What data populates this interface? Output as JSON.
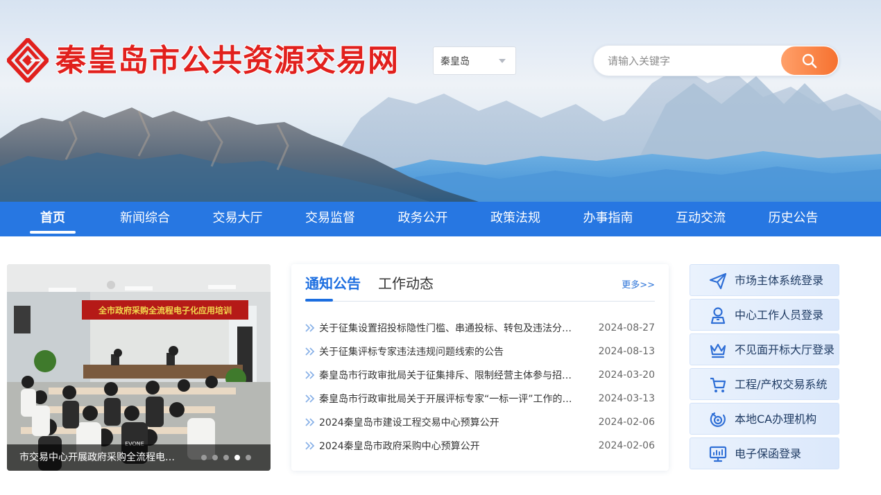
{
  "header": {
    "site_title": "秦皇岛市公共资源交易网",
    "region_select": {
      "value": "秦皇岛"
    },
    "search": {
      "placeholder": "请输入关键字"
    }
  },
  "nav": {
    "items": [
      {
        "label": "首页",
        "active": true
      },
      {
        "label": "新闻综合"
      },
      {
        "label": "交易大厅"
      },
      {
        "label": "交易监督"
      },
      {
        "label": "政务公开"
      },
      {
        "label": "政策法规"
      },
      {
        "label": "办事指南"
      },
      {
        "label": "互动交流"
      },
      {
        "label": "历史公告"
      }
    ]
  },
  "carousel": {
    "photo_banner_text": "全市政府采购全流程电子化应用培训",
    "shirt_text": "EVONE",
    "caption": "市交易中心开展政府采购全流程电子化应用培训",
    "slide_count": 5,
    "active_slide": 4
  },
  "notices": {
    "tabs": [
      "通知公告",
      "工作动态"
    ],
    "active_tab": 0,
    "more": "更多>>",
    "items": [
      {
        "title": "关于征集设置招投标隐性门槛、串通投标、转包及违法分包等违法违规问题线索的公告",
        "date": "2024-08-27"
      },
      {
        "title": "关于征集评标专家违法违规问题线索的公告",
        "date": "2024-08-13"
      },
      {
        "title": "秦皇岛市行政审批局关于征集排斥、限制经营主体参与招投标问题线索的公告",
        "date": "2024-03-20"
      },
      {
        "title": "秦皇岛市行政审批局关于开展评标专家“一标一评”工作的通知",
        "date": "2024-03-13"
      },
      {
        "title": "2024秦皇岛市建设工程交易中心预算公开",
        "date": "2024-02-06"
      },
      {
        "title": "2024秦皇岛市政府采购中心预算公开",
        "date": "2024-02-06"
      }
    ]
  },
  "quick_links": [
    {
      "label": "市场主体系统登录",
      "icon": "paper-plane-icon"
    },
    {
      "label": "中心工作人员登录",
      "icon": "staff-user-icon"
    },
    {
      "label": "不见面开标大厅登录",
      "icon": "crown-icon"
    },
    {
      "label": "工程/产权交易系统",
      "icon": "shopping-cart-icon"
    },
    {
      "label": "本地CA办理机构",
      "icon": "target-icon"
    },
    {
      "label": "电子保函登录",
      "icon": "monitor-icon"
    }
  ],
  "colors": {
    "brand_red": "#e1201d",
    "nav_blue": "#2777e2",
    "accent_blue": "#1c6ee0",
    "search_orange": "#f6712f"
  }
}
